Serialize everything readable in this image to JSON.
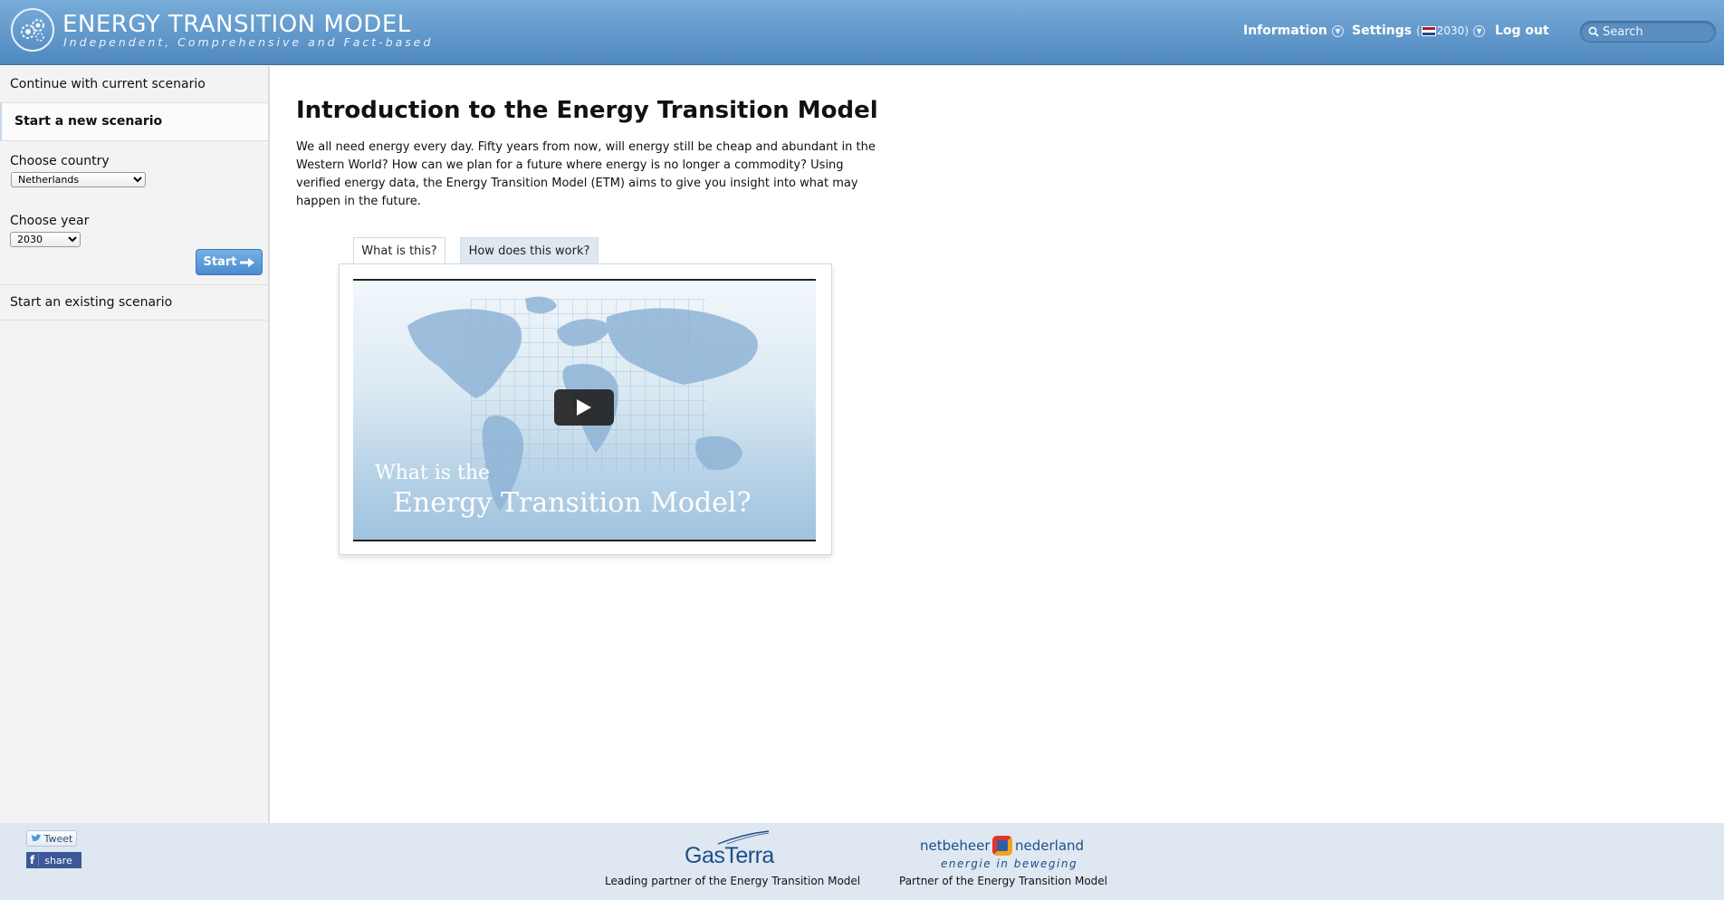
{
  "header": {
    "title": "ENERGY TRANSITION MODEL",
    "tagline": "Independent, Comprehensive and Fact-based",
    "nav": {
      "information": "Information",
      "settings": "Settings",
      "settings_year": "2030",
      "logout": "Log out"
    },
    "search_placeholder": "Search"
  },
  "sidebar": {
    "continue_label": "Continue with current scenario",
    "new_scenario_label": "Start a new scenario",
    "country_label": "Choose country",
    "country_value": "Netherlands",
    "year_label": "Choose year",
    "year_value": "2030",
    "start_label": "Start",
    "existing_label": "Start an existing scenario"
  },
  "main": {
    "title": "Introduction to the Energy Transition Model",
    "intro": "We all need energy every day. Fifty years from now, will energy still be cheap and abundant in the Western World? How can we plan for a future where energy is no longer a commodity? Using verified energy data, the Energy Transition Model (ETM) aims to give you insight into what may happen in the future.",
    "tabs": [
      "What is this?",
      "How does this work?"
    ],
    "video": {
      "caption_line1": "What is the",
      "caption_line2": "Energy Transition Model?"
    }
  },
  "footer": {
    "tweet_label": "Tweet",
    "share_label": "share",
    "partners": [
      {
        "name": "GasTerra",
        "caption": "Leading partner of the Energy Transition Model"
      },
      {
        "name_left": "netbeheer",
        "name_right": "nederland",
        "subtitle": "energie in beweging",
        "caption": "Partner of the Energy Transition Model"
      }
    ]
  },
  "colors": {
    "header_top": "#78acd8",
    "header_bottom": "#4f88c0",
    "button_blue": "#4a8ccf",
    "footer_bg": "#dfe7f1"
  }
}
